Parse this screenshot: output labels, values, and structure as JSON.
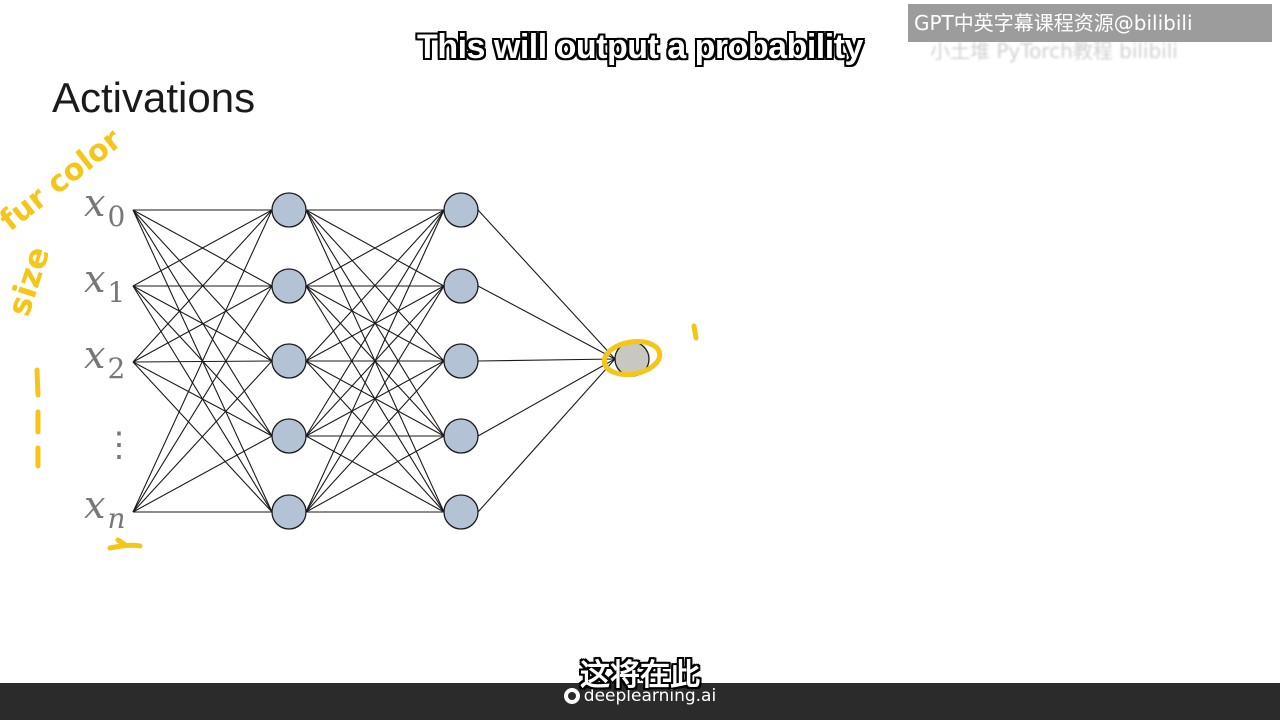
{
  "watermark": {
    "text": "GPT中英字幕课程资源@bilibili",
    "sub_text": "小土堆 PyTorch教程 bilibili"
  },
  "subtitle_top": "This will output a probability",
  "slide": {
    "title": "Activations"
  },
  "diagram": {
    "inputs": [
      {
        "base": "x",
        "sub": "0"
      },
      {
        "base": "x",
        "sub": "1"
      },
      {
        "base": "x",
        "sub": "2"
      },
      {
        "base": "x",
        "sub": "n"
      }
    ],
    "ellipsis": "⋮",
    "hidden_layers": [
      5,
      5
    ],
    "output_nodes": 1,
    "node_fill": "#b4c2d6",
    "output_fill": "#c8c8c0",
    "annotation_color": "#f5c518",
    "annotations": [
      "fur color",
      "size"
    ]
  },
  "subtitle_bottom": "这将在此",
  "footer": {
    "brand": "deeplearning.ai"
  }
}
